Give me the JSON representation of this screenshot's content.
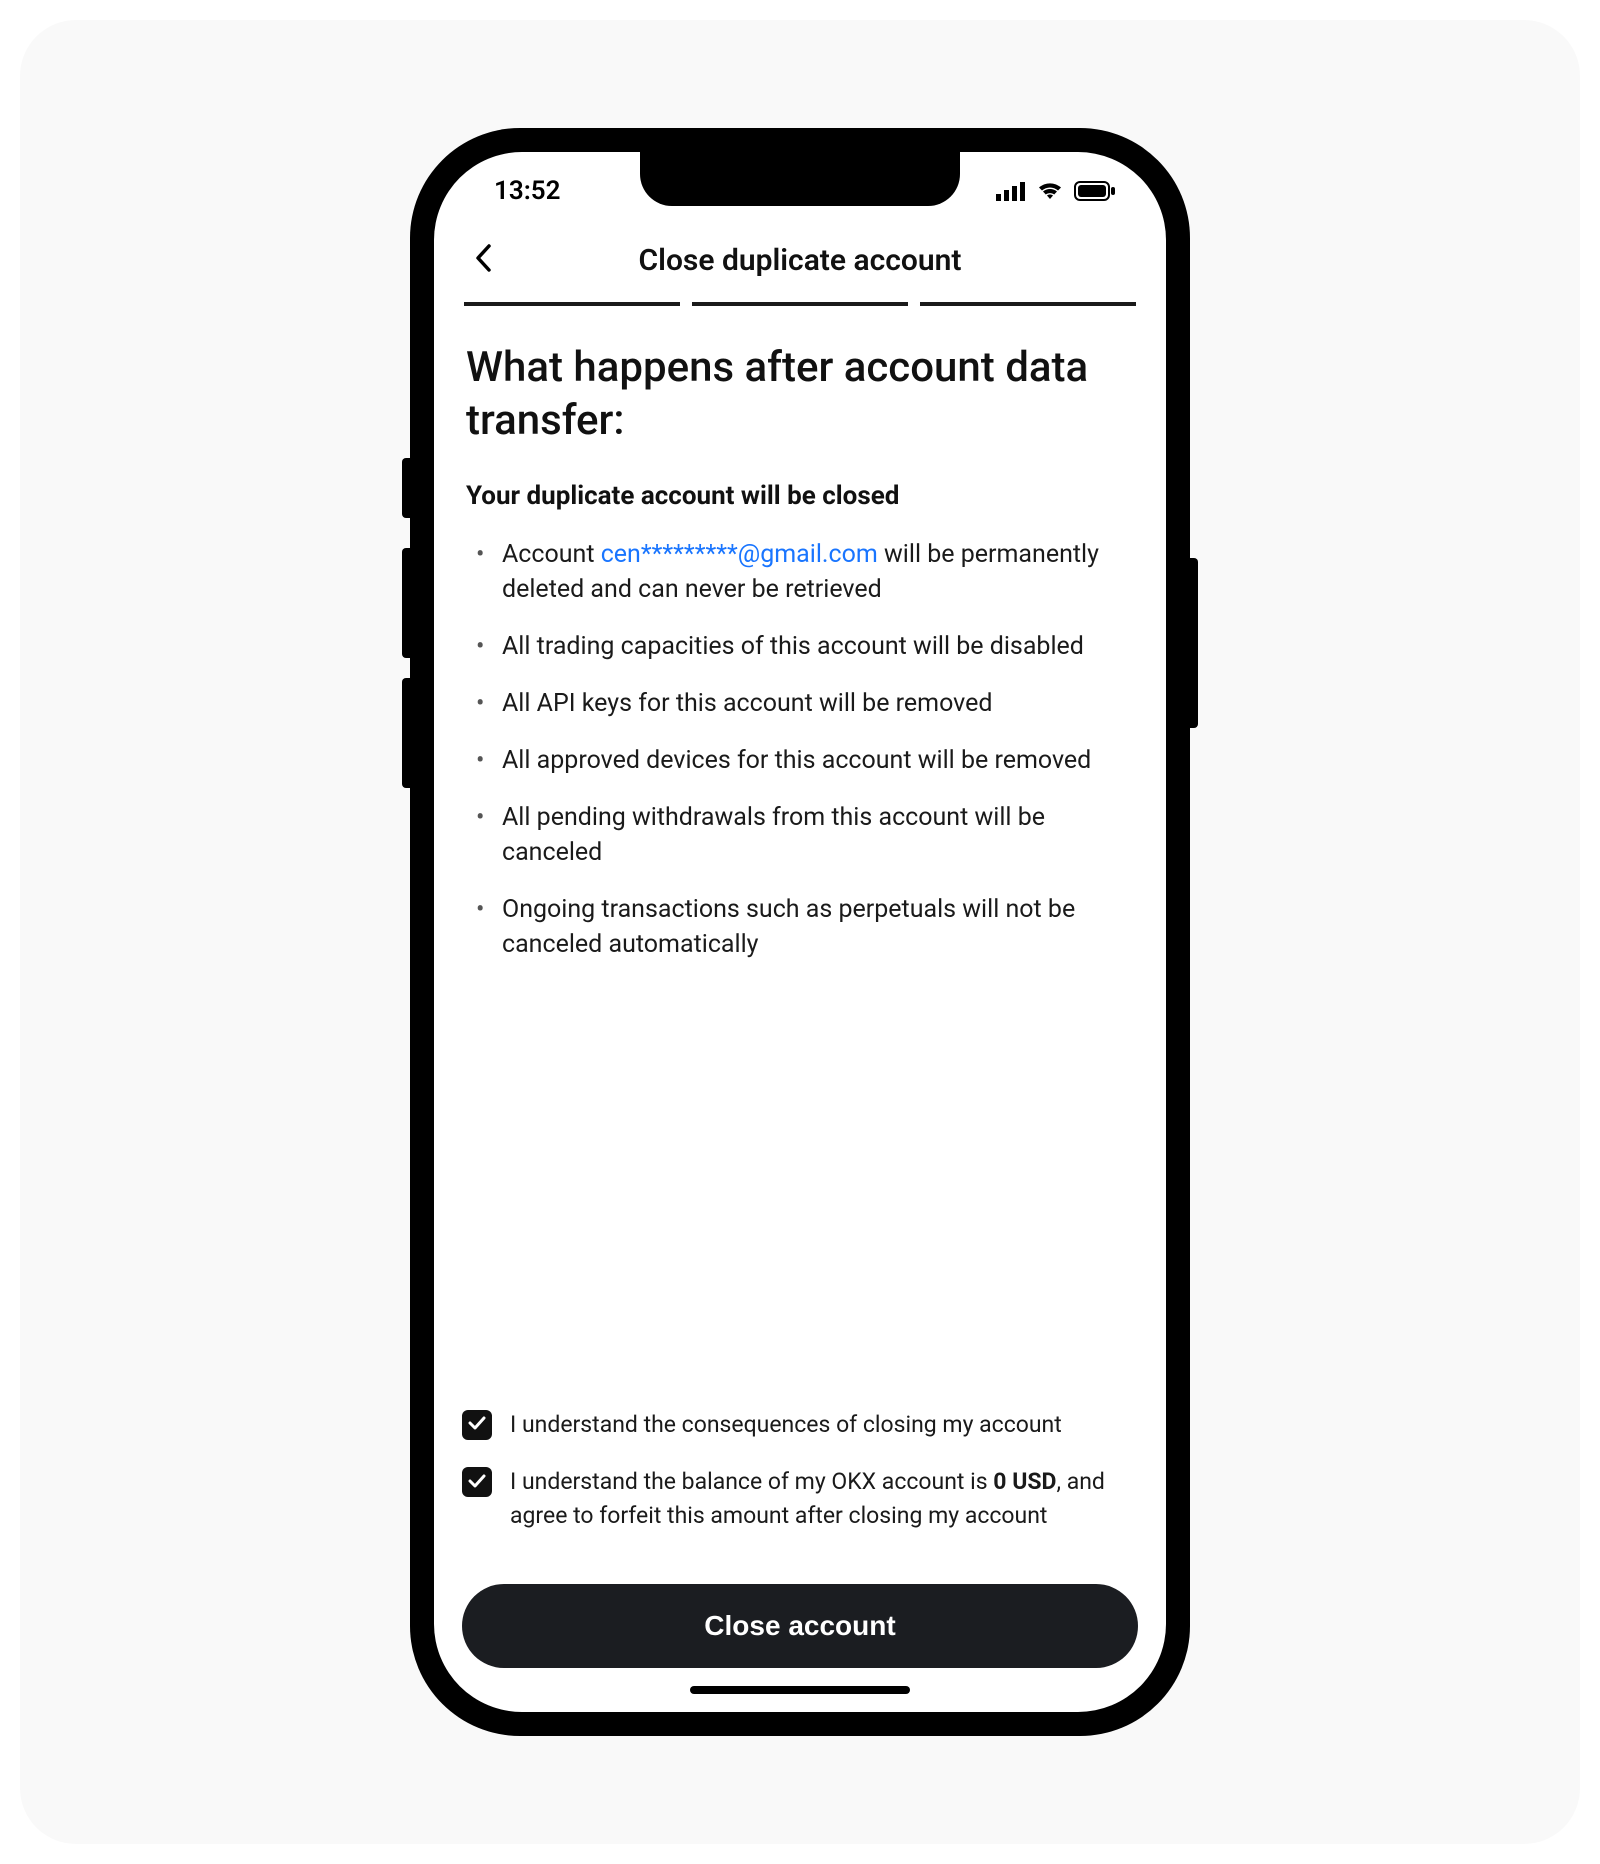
{
  "statusbar": {
    "time": "13:52"
  },
  "nav": {
    "title": "Close duplicate account"
  },
  "heading": "What happens after account data transfer:",
  "sub_heading": "Your duplicate account will be closed",
  "account": {
    "prefix": "Account ",
    "email": "cen*********@gmail.com",
    "suffix": " will be permanently deleted and can never be retrieved"
  },
  "bullets": {
    "b2": "All trading capacities of this account will be disabled",
    "b3": "All API keys for this account will be removed",
    "b4": "All approved devices for this account will be removed",
    "b5": "All pending withdrawals from this account will be canceled",
    "b6": "Ongoing transactions such as perpetuals will not be canceled automatically"
  },
  "checks": {
    "c1": "I understand the consequences of closing my account",
    "c2_pre": "I understand the balance of my OKX account is ",
    "c2_bold": "0 USD",
    "c2_post": ", and agree to forfeit this amount after closing my account"
  },
  "button": {
    "close_label": "Close account"
  }
}
